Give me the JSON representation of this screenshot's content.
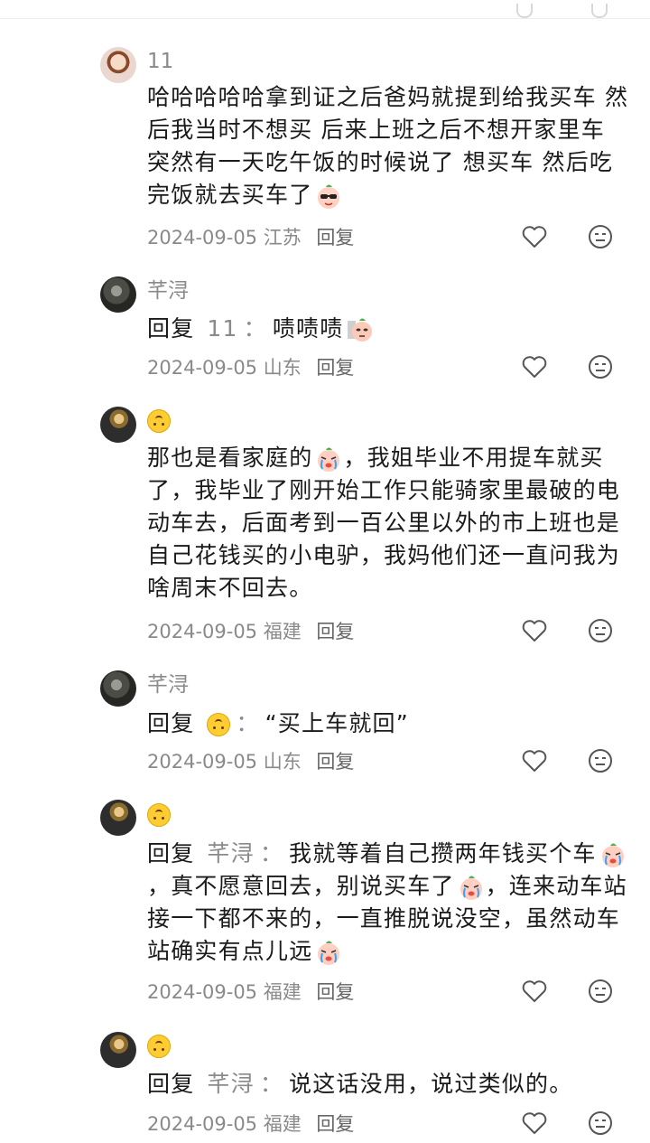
{
  "comments": [
    {
      "username": "11",
      "text": "哈哈哈哈哈拿到证之后爸妈就提到给我买车 然后我当时不想买 后来上班之后不想开家里车 突然有一天吃午饭的时候说了 想买车 然后吃完饭就去买车了",
      "sticker": "sunglasses-peach-sticker",
      "date": "2024-09-05",
      "location": "江苏",
      "reply_label": "回复"
    },
    {
      "username": "芊浔",
      "reply_word": "回复",
      "reply_to": "11",
      "colon": "：",
      "text": "啧啧啧",
      "sticker": "peach-sticker",
      "date": "2024-09-05",
      "location": "山东",
      "reply_label": "回复"
    },
    {
      "username": "upside-down-face",
      "text_parts": [
        "那也是看家庭的",
        "，我姐毕业不用提车就买了，我毕业了刚开始工作只能骑家里最破的电动车去，后面考到一百公里以外的市上班也是自己花钱买的小电驴，我妈他们还一直问我为啥周末不回去。"
      ],
      "sticker": "crying-peach-sticker",
      "date": "2024-09-05",
      "location": "福建",
      "reply_label": "回复"
    },
    {
      "username": "芊浔",
      "reply_word": "回复",
      "reply_to": "upside-down-face",
      "colon": "：",
      "text": "“买上车就回”",
      "date": "2024-09-05",
      "location": "山东",
      "reply_label": "回复"
    },
    {
      "username": "upside-down-face",
      "reply_word": "回复",
      "reply_to": "芊浔",
      "colon": "：",
      "text_parts": [
        "我就等着自己攒两年钱买个车",
        "，真不愿意回去，别说买车了",
        "，连来动车站接一下都不来的，一直推脱说没空，虽然动车站确实有点儿远"
      ],
      "sticker": "crying-peach-sticker",
      "date": "2024-09-05",
      "location": "福建",
      "reply_label": "回复"
    },
    {
      "username": "upside-down-face",
      "reply_word": "回复",
      "reply_to": "芊浔",
      "colon": "：",
      "text": "说这话没用，说过类似的。",
      "date": "2024-09-05",
      "location": "福建",
      "reply_label": "回复"
    }
  ],
  "icons": {
    "like": "heart-outline-icon",
    "dislike": "neutral-face-icon"
  },
  "colors": {
    "text": "#1a1a1a",
    "muted": "#8a8a8a",
    "icon": "#555555",
    "background": "#ffffff"
  }
}
